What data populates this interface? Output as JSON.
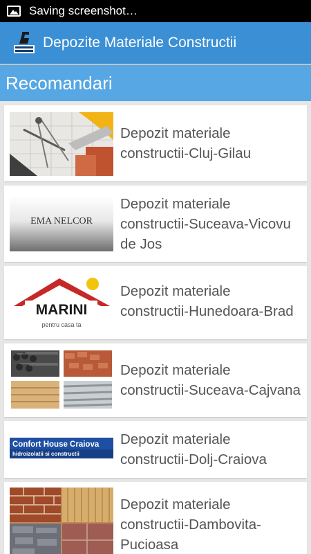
{
  "status_bar": {
    "text": "Saving screenshot…",
    "icon": "image-icon"
  },
  "action_bar": {
    "title": "Depozite Materiale Constructii",
    "logo_icon": "builder-logo-icon"
  },
  "section": {
    "title": "Recomandari"
  },
  "items": [
    {
      "label": "Depozit materiale constructii-Cluj-Gilau",
      "image": "drafting-tools-image"
    },
    {
      "label": "Depozit materiale constructii-Suceava-Vicovu de Jos",
      "image": "ema-nelcor-logo",
      "logo_text": "EMA NELCOR"
    },
    {
      "label": "Depozit materiale constructii-Hunedoara-Brad",
      "image": "marini-logo",
      "logo_text": "MARINI",
      "logo_sub": "pentru casa ta"
    },
    {
      "label": "Depozit materiale constructii-Suceava-Cajvana",
      "image": "building-materials-collage"
    },
    {
      "label": "Depozit materiale constructii-Dolj-Craiova",
      "image": "confort-house-logo",
      "logo_text": "Confort House Craiova",
      "logo_sub": "hidroizolatii si constructii"
    },
    {
      "label": "Depozit materiale constructii-Dambovita-Pucioasa",
      "image": "stone-tiles-collage"
    }
  ],
  "colors": {
    "action_bar": "#3b8fd4",
    "section_header": "#56a7e3",
    "background": "#e6e6e6"
  }
}
